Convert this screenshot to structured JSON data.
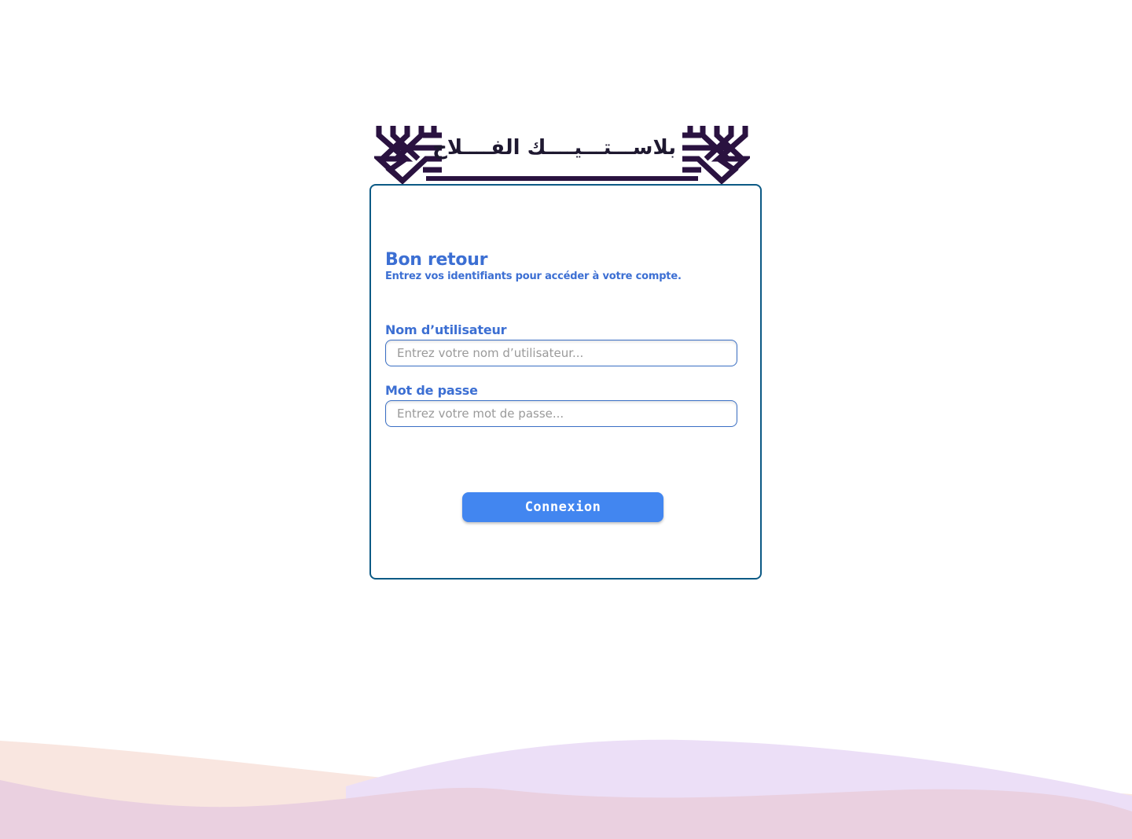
{
  "brand": {
    "logo_text": "بلاســـتـــيــــك الفــــلاح",
    "logo_color": "#2a1240"
  },
  "login": {
    "title": "Bon retour",
    "subtitle": "Entrez vos identifiants pour accéder à votre compte.",
    "username": {
      "label": "Nom d’utilisateur",
      "placeholder": "Entrez votre nom d’utilisateur...",
      "value": ""
    },
    "password": {
      "label": "Mot de passe",
      "placeholder": "Entrez votre mot de passe...",
      "value": ""
    },
    "submit_label": "Connexion"
  },
  "colors": {
    "accent": "#3c6fd3",
    "button": "#4286f0",
    "card_border": "#0c5a85",
    "wave_peach": "#f9e6e0",
    "wave_lavender": "#ecdff7",
    "wave_pink": "#ead0e0"
  }
}
